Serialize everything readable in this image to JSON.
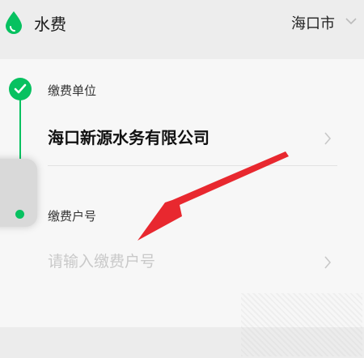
{
  "header": {
    "title": "水费",
    "city": "海口市",
    "icon": "water-drop-icon",
    "brand_color": "#07c160"
  },
  "form": {
    "unit_label": "缴费单位",
    "unit_value": "海口新源水务有限公司",
    "account_label": "缴费户号",
    "account_placeholder": "请输入缴费户号"
  },
  "annotation": {
    "arrow_color": "#e8282f"
  }
}
